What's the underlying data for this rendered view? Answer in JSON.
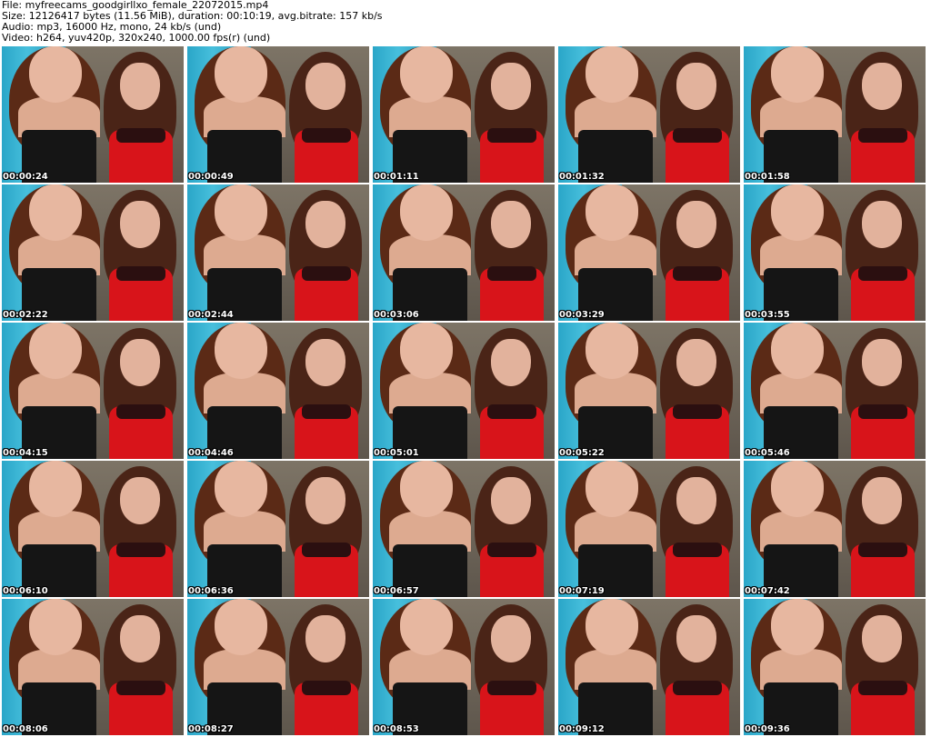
{
  "header": {
    "file_line": "File: myfreecams_goodgirllxo_female_22072015.mp4",
    "size_line": "Size: 12126417 bytes (11.56 MiB), duration: 00:10:19, avg.bitrate: 157 kb/s",
    "audio_line": "Audio: mp3, 16000 Hz, mono, 24 kb/s (und)",
    "video_line": "Video: h264, yuv420p, 320x240, 1000.00 fps(r) (und)"
  },
  "colors": {
    "curtain": "#2aa6c8",
    "wall": "#6e6658",
    "black_top": "#151515",
    "red_dress": "#d8141a",
    "timestamp_text": "#ffffff"
  },
  "thumbnails": [
    {
      "timestamp": "00:00:24"
    },
    {
      "timestamp": "00:00:49"
    },
    {
      "timestamp": "00:01:11"
    },
    {
      "timestamp": "00:01:32"
    },
    {
      "timestamp": "00:01:58"
    },
    {
      "timestamp": "00:02:22"
    },
    {
      "timestamp": "00:02:44"
    },
    {
      "timestamp": "00:03:06"
    },
    {
      "timestamp": "00:03:29"
    },
    {
      "timestamp": "00:03:55"
    },
    {
      "timestamp": "00:04:15"
    },
    {
      "timestamp": "00:04:46"
    },
    {
      "timestamp": "00:05:01"
    },
    {
      "timestamp": "00:05:22"
    },
    {
      "timestamp": "00:05:46"
    },
    {
      "timestamp": "00:06:10"
    },
    {
      "timestamp": "00:06:36"
    },
    {
      "timestamp": "00:06:57"
    },
    {
      "timestamp": "00:07:19"
    },
    {
      "timestamp": "00:07:42"
    },
    {
      "timestamp": "00:08:06"
    },
    {
      "timestamp": "00:08:27"
    },
    {
      "timestamp": "00:08:53"
    },
    {
      "timestamp": "00:09:12"
    },
    {
      "timestamp": "00:09:36"
    }
  ]
}
